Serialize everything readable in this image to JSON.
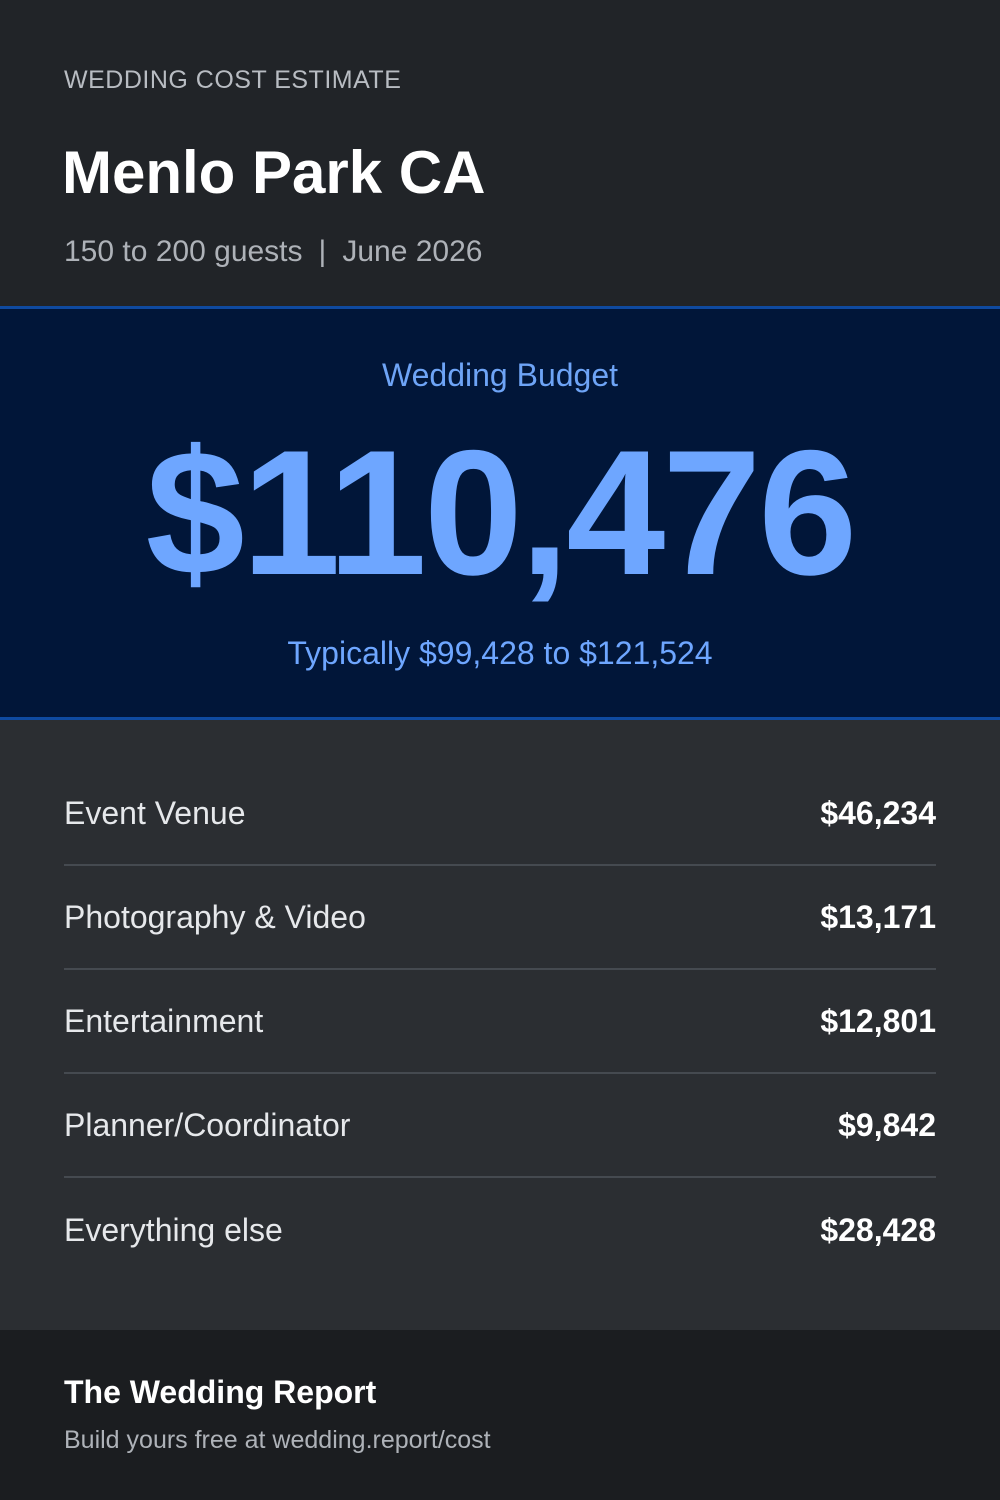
{
  "header": {
    "eyebrow": "WEDDING COST ESTIMATE",
    "location": "Menlo Park CA",
    "guests": "150 to 200 guests",
    "separator": "|",
    "date": "June 2026"
  },
  "budget": {
    "label": "Wedding Budget",
    "amount": "$110,476",
    "range": "Typically $99,428 to $121,524"
  },
  "breakdown": [
    {
      "label": "Event Venue",
      "value": "$46,234"
    },
    {
      "label": "Photography & Video",
      "value": "$13,171"
    },
    {
      "label": "Entertainment",
      "value": "$12,801"
    },
    {
      "label": "Planner/Coordinator",
      "value": "$9,842"
    },
    {
      "label": "Everything else",
      "value": "$28,428"
    }
  ],
  "footer": {
    "brand": "The Wedding Report",
    "tagline": "Build yours free at wedding.report/cost"
  },
  "colors": {
    "accent": "#6ea6ff",
    "budget_bg": "#011639",
    "border_accent": "#0f4aa0"
  }
}
